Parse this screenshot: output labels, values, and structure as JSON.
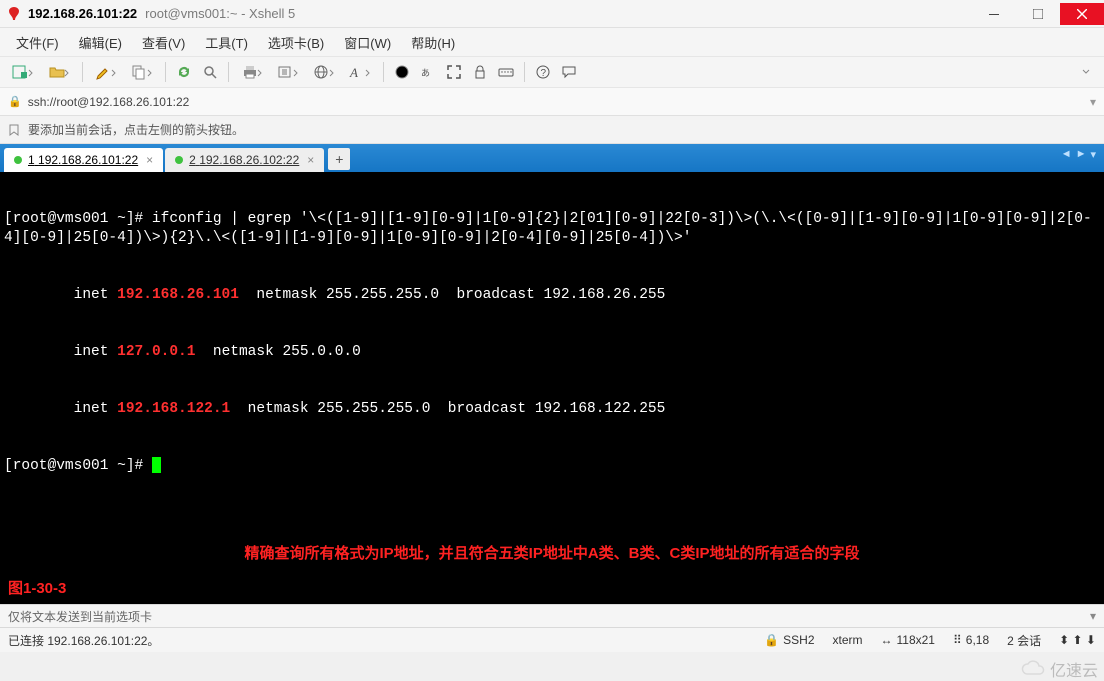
{
  "window": {
    "ip_title": "192.168.26.101:22",
    "subtitle": "root@vms001:~ - Xshell 5"
  },
  "menu": {
    "file": "文件(F)",
    "edit": "编辑(E)",
    "view": "查看(V)",
    "tools": "工具(T)",
    "tab": "选项卡(B)",
    "window": "窗口(W)",
    "help": "帮助(H)"
  },
  "toolbar_icons": {
    "new": "new-tab",
    "open": "open",
    "edit": "edit",
    "copy": "copy",
    "reconnect": "reconnect",
    "disconnect": "disconnect",
    "print": "print",
    "file-transfer": "file-transfer",
    "globe": "globe",
    "font": "font",
    "colors": "colors",
    "fullscreen": "fullscreen",
    "lock": "lock",
    "keys": "keys",
    "help": "help",
    "chat": "chat"
  },
  "address": {
    "url": "ssh://root@192.168.26.101:22"
  },
  "hint": {
    "text": "要添加当前会话，点击左侧的箭头按钮。"
  },
  "tabs": [
    {
      "index": "1",
      "label": "192.168.26.101:22",
      "active": true
    },
    {
      "index": "2",
      "label": "192.168.26.102:22",
      "active": false
    }
  ],
  "terminal": {
    "cmd_line1": "[root@vms001 ~]# ifconfig | egrep '\\<([1-9]|[1-9][0-9]|1[0-9]{2}|2[01][0-9]|22[0-3])\\>(\\.\\<([0-9]|[1-9][0-9]|1[0-9][0-9]|2[0-4][0-9]|25[0-4])\\>){2}\\.\\<([1-9]|[1-9][0-9]|1[0-9][0-9]|2[0-4][0-9]|25[0-4])\\>'",
    "row1_pre": "        inet ",
    "row1_ip": "192.168.26.101",
    "row1_rest": "  netmask 255.255.255.0  broadcast 192.168.26.255",
    "row2_pre": "        inet ",
    "row2_ip": "127.0.0.1",
    "row2_rest": "  netmask 255.0.0.0",
    "row3_pre": "        inet ",
    "row3_ip": "192.168.122.1",
    "row3_rest": "  netmask 255.255.255.0  broadcast 192.168.122.255",
    "prompt2": "[root@vms001 ~]# ",
    "annotation": "精确查询所有格式为IP地址，并且符合五类IP地址中A类、B类、C类IP地址的所有适合的字段",
    "figure_label": "图1-30-3"
  },
  "sendbar": {
    "text": "仅将文本发送到当前选项卡"
  },
  "status": {
    "connected": "已连接 192.168.26.101:22。",
    "proto": "SSH2",
    "term": "xterm",
    "size": "118x21",
    "cursor": "6,18",
    "sessions": "2 会话"
  },
  "watermark": {
    "text": "亿速云"
  }
}
